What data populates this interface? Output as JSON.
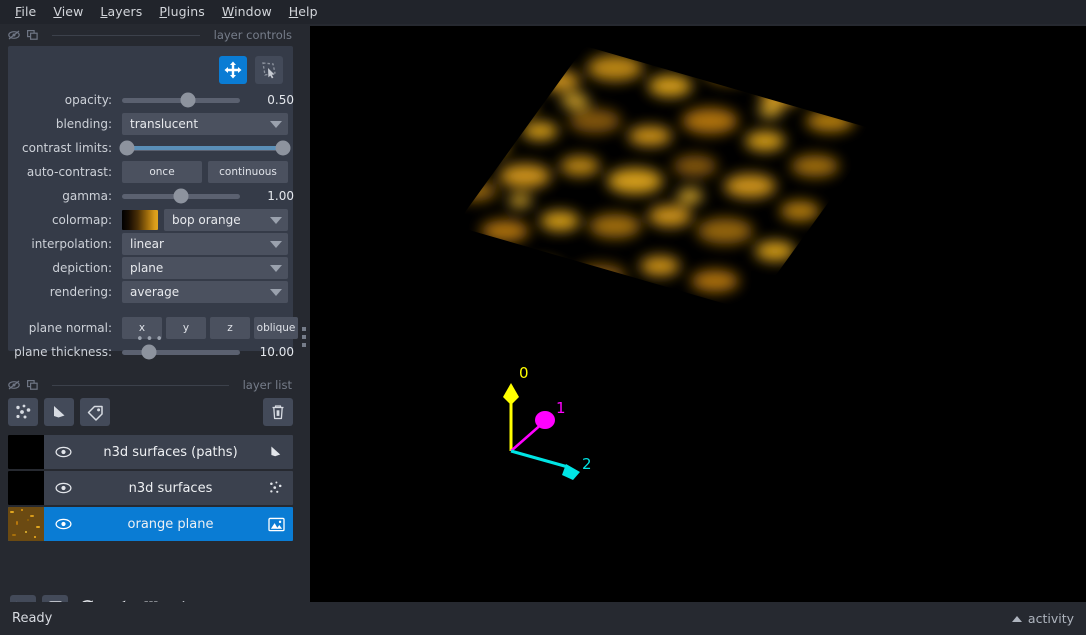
{
  "menubar": {
    "items": [
      {
        "label": "File",
        "accel": "F"
      },
      {
        "label": "View",
        "accel": "V"
      },
      {
        "label": "Layers",
        "accel": "L"
      },
      {
        "label": "Plugins",
        "accel": "P"
      },
      {
        "label": "Window",
        "accel": "W"
      },
      {
        "label": "Help",
        "accel": "H"
      }
    ]
  },
  "layer_controls": {
    "section_title": "layer controls",
    "mode_buttons": [
      {
        "name": "pan-zoom",
        "icon": "move-icon",
        "active": true
      },
      {
        "name": "transform",
        "icon": "transform-icon",
        "active": false
      }
    ],
    "opacity": {
      "label": "opacity:",
      "value": "0.50",
      "fraction": 0.5
    },
    "blending": {
      "label": "blending:",
      "value": "translucent"
    },
    "contrast_limits": {
      "label": "contrast limits:",
      "low": 0,
      "high": 1
    },
    "auto_contrast": {
      "label": "auto-contrast:",
      "once": "once",
      "continuous": "continuous"
    },
    "gamma": {
      "label": "gamma:",
      "value": "1.00",
      "fraction": 0.38
    },
    "colormap": {
      "label": "colormap:",
      "value": "bop orange"
    },
    "interpolation": {
      "label": "interpolation:",
      "value": "linear"
    },
    "depiction": {
      "label": "depiction:",
      "value": "plane"
    },
    "rendering": {
      "label": "rendering:",
      "value": "average"
    },
    "plane_normal": {
      "label": "plane normal:",
      "options": [
        "x",
        "y",
        "z",
        "oblique"
      ]
    },
    "plane_thickness": {
      "label": "plane thickness:",
      "value": "10.00",
      "fraction": 0.175
    },
    "expander": "•••"
  },
  "layer_list": {
    "section_title": "layer list",
    "buttons": [
      {
        "name": "new-points-layer",
        "icon": "points-icon"
      },
      {
        "name": "new-shapes-layer",
        "icon": "shapes-icon"
      },
      {
        "name": "new-labels-layer",
        "icon": "labels-icon"
      },
      {
        "name": "delete-layer",
        "icon": "trash-icon"
      }
    ],
    "layers": [
      {
        "name": "n3d surfaces (paths)",
        "type": "shapes",
        "visible": true,
        "selected": false,
        "thumb": "black"
      },
      {
        "name": "n3d surfaces",
        "type": "points",
        "visible": true,
        "selected": false,
        "thumb": "black"
      },
      {
        "name": "orange plane",
        "type": "image",
        "visible": true,
        "selected": true,
        "thumb": "orange-noise"
      }
    ]
  },
  "bottom_toolbar": {
    "buttons": [
      {
        "name": "console",
        "icon": "terminal-icon",
        "active": false
      },
      {
        "name": "toggle-ndisplay",
        "icon": "cube-3d-icon",
        "active": true
      },
      {
        "name": "roll-dimensions",
        "icon": "roll-icon",
        "active": false
      },
      {
        "name": "transpose-dimensions",
        "icon": "transpose-icon",
        "active": false
      },
      {
        "name": "grid-view",
        "icon": "grid-icon",
        "active": false
      },
      {
        "name": "home",
        "icon": "home-icon",
        "active": false
      }
    ]
  },
  "canvas": {
    "background": "#000000",
    "axes": [
      {
        "label": "0",
        "color": "#ffff00"
      },
      {
        "label": "1",
        "color": "#ff00ff"
      },
      {
        "label": "2",
        "color": "#00e5e5"
      }
    ],
    "volume_colormap": "bop orange"
  },
  "statusbar": {
    "status": "Ready",
    "activity_label": "activity"
  },
  "colors": {
    "accent": "#0a7cd4",
    "panel": "#353b48",
    "dock": "#262930",
    "menubar": "#21242b",
    "widget": "#4b515f"
  }
}
